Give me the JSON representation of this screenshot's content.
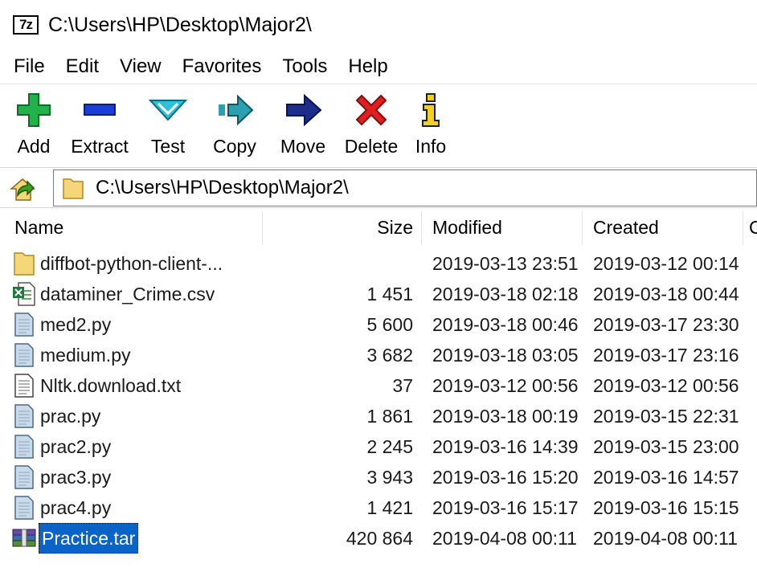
{
  "window": {
    "app_icon_text": "7z",
    "title": "C:\\Users\\HP\\Desktop\\Major2\\"
  },
  "menu": [
    "File",
    "Edit",
    "View",
    "Favorites",
    "Tools",
    "Help"
  ],
  "toolbar": {
    "add": "Add",
    "extract": "Extract",
    "test": "Test",
    "copy": "Copy",
    "move": "Move",
    "delete": "Delete",
    "info": "Info"
  },
  "address": {
    "path": "C:\\Users\\HP\\Desktop\\Major2\\"
  },
  "columns": {
    "name": "Name",
    "size": "Size",
    "modified": "Modified",
    "created": "Created",
    "extra": "C"
  },
  "files": [
    {
      "name": "diffbot-python-client-...",
      "size": "",
      "modified": "2019-03-13 23:51",
      "created": "2019-03-12 00:14",
      "icon": "folder-icon"
    },
    {
      "name": "dataminer_Crime.csv",
      "size": "1 451",
      "modified": "2019-03-18 02:18",
      "created": "2019-03-18 00:44",
      "icon": "excel-file-icon"
    },
    {
      "name": "med2.py",
      "size": "5 600",
      "modified": "2019-03-18 00:46",
      "created": "2019-03-17 23:30",
      "icon": "python-file-icon"
    },
    {
      "name": "medium.py",
      "size": "3 682",
      "modified": "2019-03-18 03:05",
      "created": "2019-03-17 23:16",
      "icon": "python-file-icon"
    },
    {
      "name": "Nltk.download.txt",
      "size": "37",
      "modified": "2019-03-12 00:56",
      "created": "2019-03-12 00:56",
      "icon": "text-file-icon"
    },
    {
      "name": "prac.py",
      "size": "1 861",
      "modified": "2019-03-18 00:19",
      "created": "2019-03-15 22:31",
      "icon": "python-file-icon"
    },
    {
      "name": "prac2.py",
      "size": "2 245",
      "modified": "2019-03-16 14:39",
      "created": "2019-03-15 23:00",
      "icon": "python-file-icon"
    },
    {
      "name": "prac3.py",
      "size": "3 943",
      "modified": "2019-03-16 15:20",
      "created": "2019-03-16 14:57",
      "icon": "python-file-icon"
    },
    {
      "name": "prac4.py",
      "size": "1 421",
      "modified": "2019-03-16 15:17",
      "created": "2019-03-16 15:15",
      "icon": "python-file-icon"
    },
    {
      "name": "Practice.tar",
      "size": "420 864",
      "modified": "2019-04-08 00:11",
      "created": "2019-04-08 00:11",
      "icon": "archive-file-icon",
      "selected": true
    }
  ],
  "colors": {
    "selection": "#0a64c8",
    "add_green": "#22b24c",
    "extract_blue": "#1a3fd6",
    "test_cyan": "#2fc0d8",
    "move_navy": "#1c2d8a",
    "delete_red": "#e02020",
    "info_yellow": "#f0d020",
    "folder_yellow": "#f5d77a"
  }
}
